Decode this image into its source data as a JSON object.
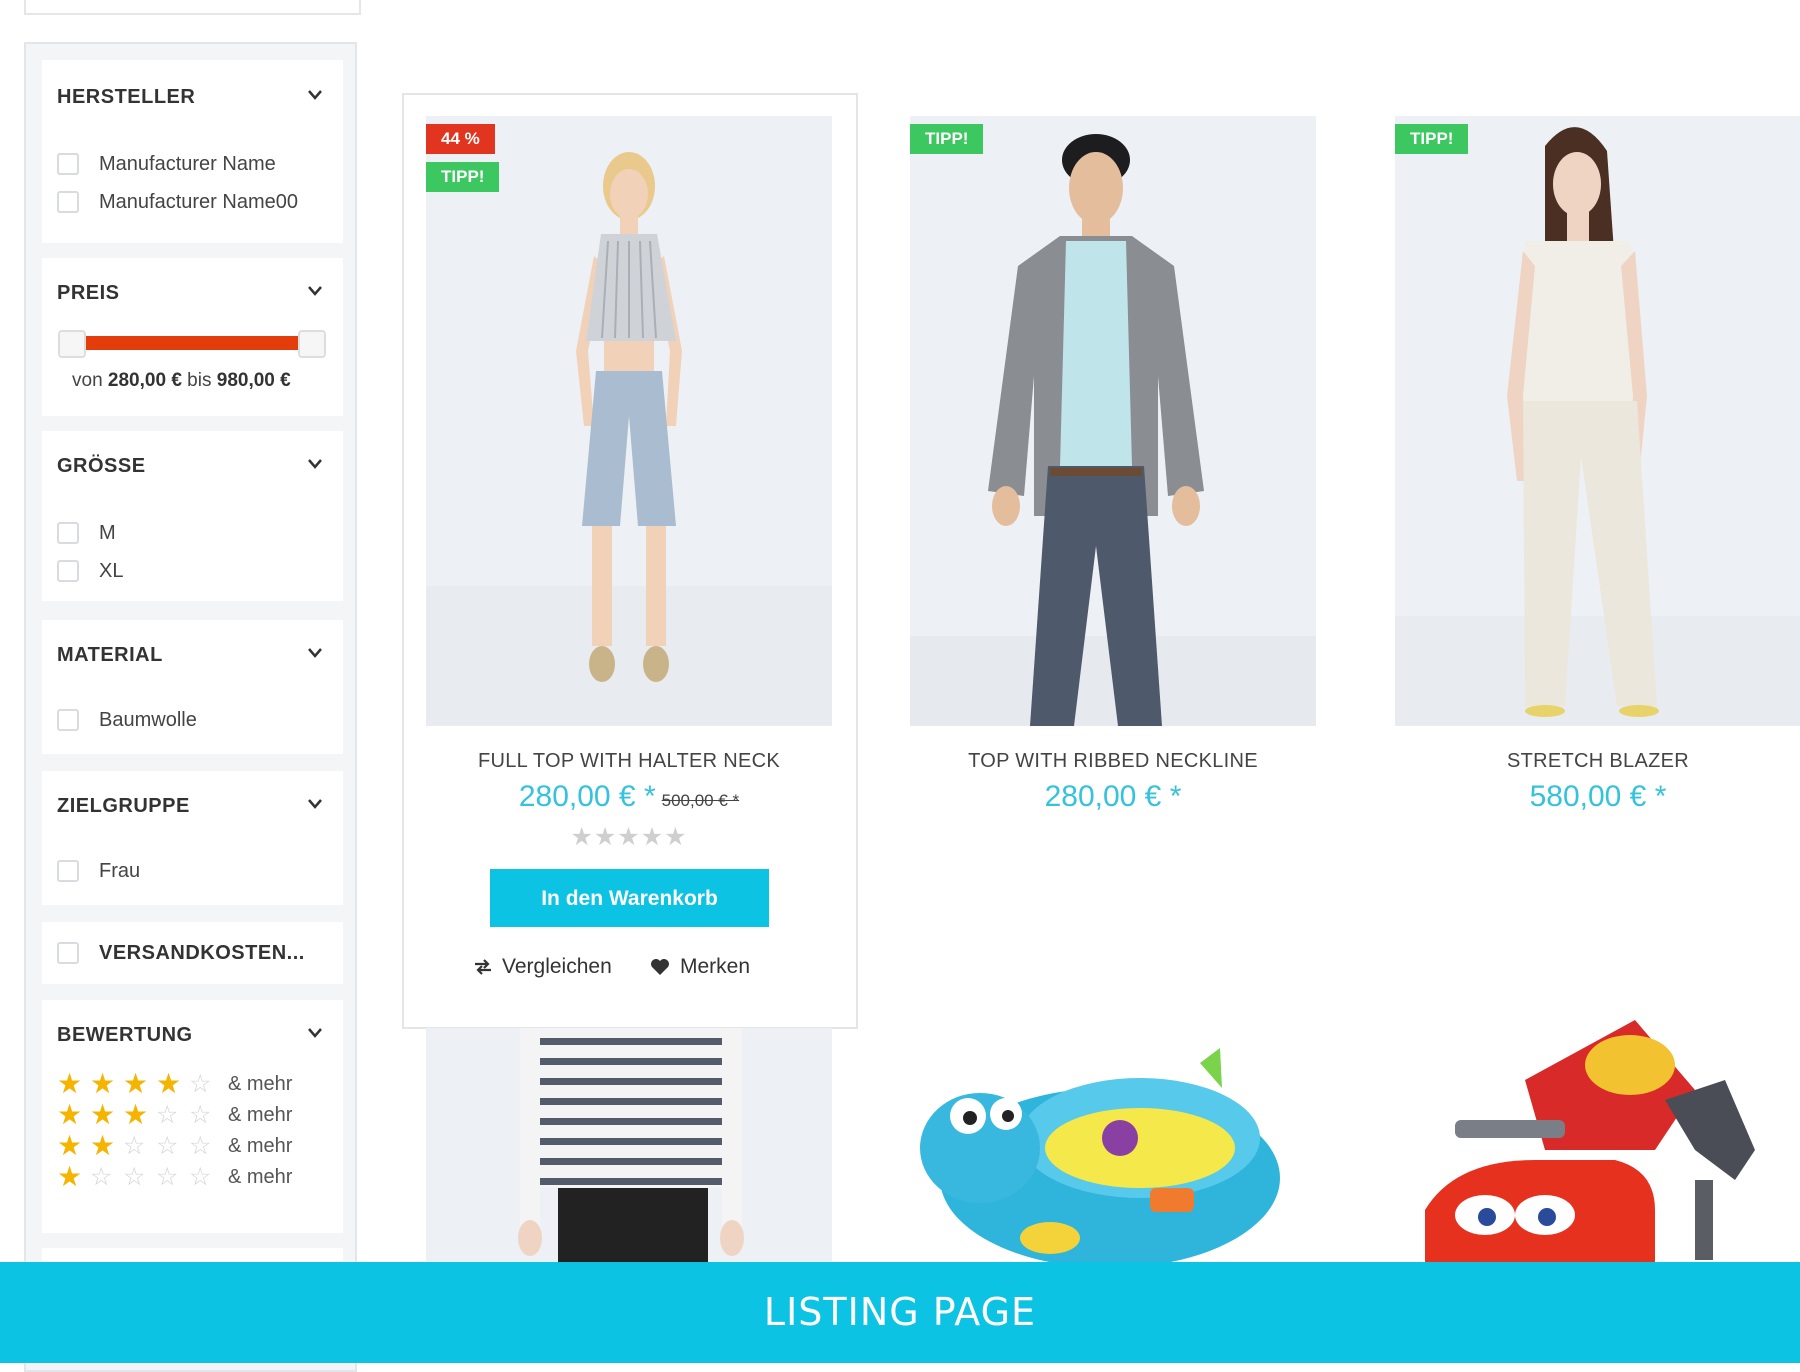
{
  "filters": {
    "manufacturer": {
      "title": "HERSTELLER",
      "options": [
        "Manufacturer Name",
        "Manufacturer Name00"
      ]
    },
    "price": {
      "title": "PREIS",
      "from_label": "von",
      "from_value": "280,00 €",
      "to_label": "bis",
      "to_value": "980,00 €"
    },
    "size": {
      "title": "GRÖSSE",
      "options": [
        "M",
        "XL"
      ]
    },
    "material": {
      "title": "MATERIAL",
      "options": [
        "Baumwolle"
      ]
    },
    "target_group": {
      "title": "ZIELGRUPPE",
      "options": [
        "Frau"
      ]
    },
    "shipping": {
      "label": "VERSANDKOSTEN..."
    },
    "rating": {
      "title": "BEWERTUNG",
      "rows": [
        {
          "stars": 4,
          "label": "& mehr"
        },
        {
          "stars": 3,
          "label": "& mehr"
        },
        {
          "stars": 2,
          "label": "& mehr"
        },
        {
          "stars": 1,
          "label": "& mehr"
        }
      ]
    }
  },
  "products": [
    {
      "name": "FULL TOP WITH HALTER NECK",
      "price": "280,00 € *",
      "old_price": "500,00 € *",
      "badges": [
        "44 %",
        "TIPP!"
      ],
      "rating": 0
    },
    {
      "name": "TOP WITH RIBBED NECKLINE",
      "price": "280,00 € *",
      "badges": [
        "TIPP!"
      ]
    },
    {
      "name": "STRETCH BLAZER",
      "price": "580,00 € *",
      "badges": [
        "TIPP!"
      ]
    }
  ],
  "actions": {
    "add_to_cart": "In den Warenkorb",
    "compare": "Vergleichen",
    "remember": "Merken"
  },
  "footer": {
    "label": "LISTING PAGE"
  },
  "colors": {
    "accent": "#0cc3e3",
    "price": "#35c2dc",
    "tipp": "#3cc761",
    "discount": "#e2351f",
    "slider": "#e33d0c",
    "star": "#f5b400"
  }
}
